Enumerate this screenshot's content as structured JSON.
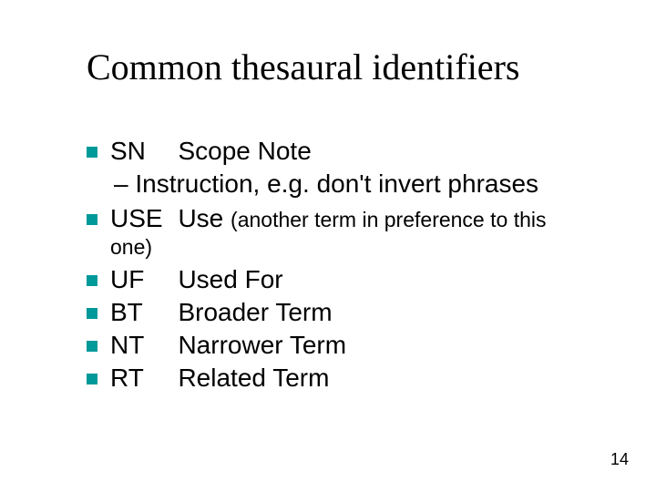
{
  "title": "Common thesaural identifiers",
  "items": {
    "sn": {
      "abbr": "SN",
      "def": "Scope Note",
      "sub": "– Instruction, e.g. don't invert phrases"
    },
    "use": {
      "abbr": "USE",
      "def_main": "Use ",
      "def_paren": "(another term in preference to this",
      "def_paren2": "one)"
    },
    "uf": {
      "abbr": "UF",
      "def": "Used For"
    },
    "bt": {
      "abbr": "BT",
      "def": "Broader Term"
    },
    "nt": {
      "abbr": "NT",
      "def": "Narrower Term"
    },
    "rt": {
      "abbr": "RT",
      "def": "Related Term"
    }
  },
  "page_number": "14"
}
